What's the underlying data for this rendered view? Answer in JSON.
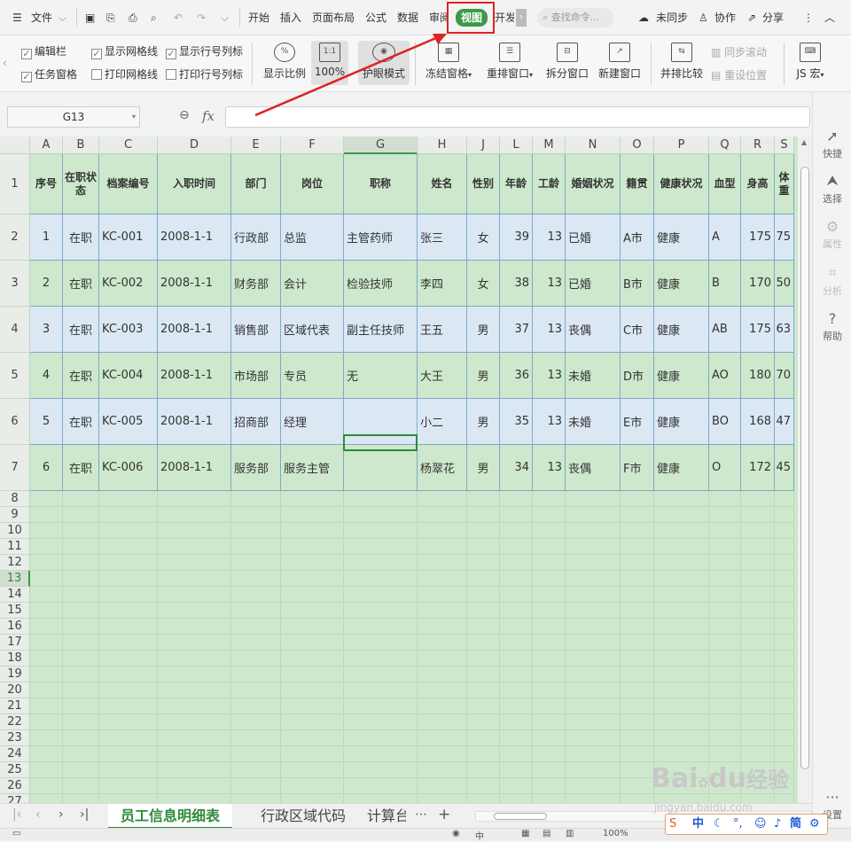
{
  "titlebar": {
    "menu_label": "文件",
    "tabs": [
      "开始",
      "插入",
      "页面布局",
      "公式",
      "数据",
      "审阅",
      "视图",
      "开发"
    ],
    "active_tab": "视图",
    "search_placeholder": "查找命令...",
    "sync_label": "未同步",
    "collab_label": "协作",
    "share_label": "分享"
  },
  "ribbon": {
    "checks": [
      {
        "label": "编辑栏",
        "checked": true
      },
      {
        "label": "显示网格线",
        "checked": true
      },
      {
        "label": "显示行号列标",
        "checked": true
      },
      {
        "label": "任务窗格",
        "checked": true
      },
      {
        "label": "打印网格线",
        "checked": false
      },
      {
        "label": "打印行号列标",
        "checked": false
      }
    ],
    "buttons": {
      "zoom_ratio": "显示比例",
      "hundred": "100%",
      "eye_mode": "护眼模式",
      "freeze": "冻结窗格",
      "rearrange": "重排窗口",
      "split": "拆分窗口",
      "new_window": "新建窗口",
      "side_compare": "并排比较",
      "sync_scroll": "同步滚动",
      "reset_position": "重设位置",
      "macro": "JS 宏"
    }
  },
  "formula_bar": {
    "name_box": "G13",
    "fx_label": "fx",
    "value": ""
  },
  "columns": [
    "A",
    "B",
    "C",
    "D",
    "E",
    "F",
    "G",
    "H",
    "J",
    "L",
    "M",
    "N",
    "O",
    "P",
    "Q",
    "R",
    "S"
  ],
  "header_row": [
    "序号",
    "在职状态",
    "档案编号",
    "入职时间",
    "部门",
    "岗位",
    "职称",
    "姓名",
    "性别",
    "年龄",
    "工龄",
    "婚姻状况",
    "籍贯",
    "健康状况",
    "血型",
    "身高",
    "体重"
  ],
  "rows": [
    [
      "1",
      "在职",
      "KC-001",
      "2008-1-1",
      "行政部",
      "总监",
      "主管药师",
      "张三",
      "女",
      "39",
      "13",
      "已婚",
      "A市",
      "健康",
      "A",
      "175",
      "75"
    ],
    [
      "2",
      "在职",
      "KC-002",
      "2008-1-1",
      "财务部",
      "会计",
      "检验技师",
      "李四",
      "女",
      "38",
      "13",
      "已婚",
      "B市",
      "健康",
      "B",
      "170",
      "50"
    ],
    [
      "3",
      "在职",
      "KC-003",
      "2008-1-1",
      "销售部",
      "区域代表",
      "副主任技师",
      "王五",
      "男",
      "37",
      "13",
      "丧偶",
      "C市",
      "健康",
      "AB",
      "175",
      "63"
    ],
    [
      "4",
      "在职",
      "KC-004",
      "2008-1-1",
      "市场部",
      "专员",
      "无",
      "大王",
      "男",
      "36",
      "13",
      "未婚",
      "D市",
      "健康",
      "AO",
      "180",
      "70"
    ],
    [
      "5",
      "在职",
      "KC-005",
      "2008-1-1",
      "招商部",
      "经理",
      "",
      "小二",
      "男",
      "35",
      "13",
      "未婚",
      "E市",
      "健康",
      "BO",
      "168",
      "47"
    ],
    [
      "6",
      "在职",
      "KC-006",
      "2008-1-1",
      "服务部",
      "服务主管",
      "",
      "杨翠花",
      "男",
      "34",
      "13",
      "丧偶",
      "F市",
      "健康",
      "O",
      "172",
      "45"
    ]
  ],
  "sheets": [
    "员工信息明细表",
    "行政区域代码",
    "计算台"
  ],
  "active_sheet": "员工信息明细表",
  "right_panel": [
    "快捷",
    "选择",
    "属性",
    "分析",
    "帮助",
    "设置"
  ],
  "status": {
    "zoom": "100%",
    "ime": "中",
    "simplified": "简"
  },
  "watermark": {
    "brand": "Bai",
    "brand2": "du",
    "brand_cn": "经验",
    "url": "jingyan.baidu.com"
  },
  "colors": {
    "accent": "#3d9a48",
    "highlight": "#e12121",
    "eye_green": "#cde8cc",
    "row_blue": "#dbe8f4"
  }
}
